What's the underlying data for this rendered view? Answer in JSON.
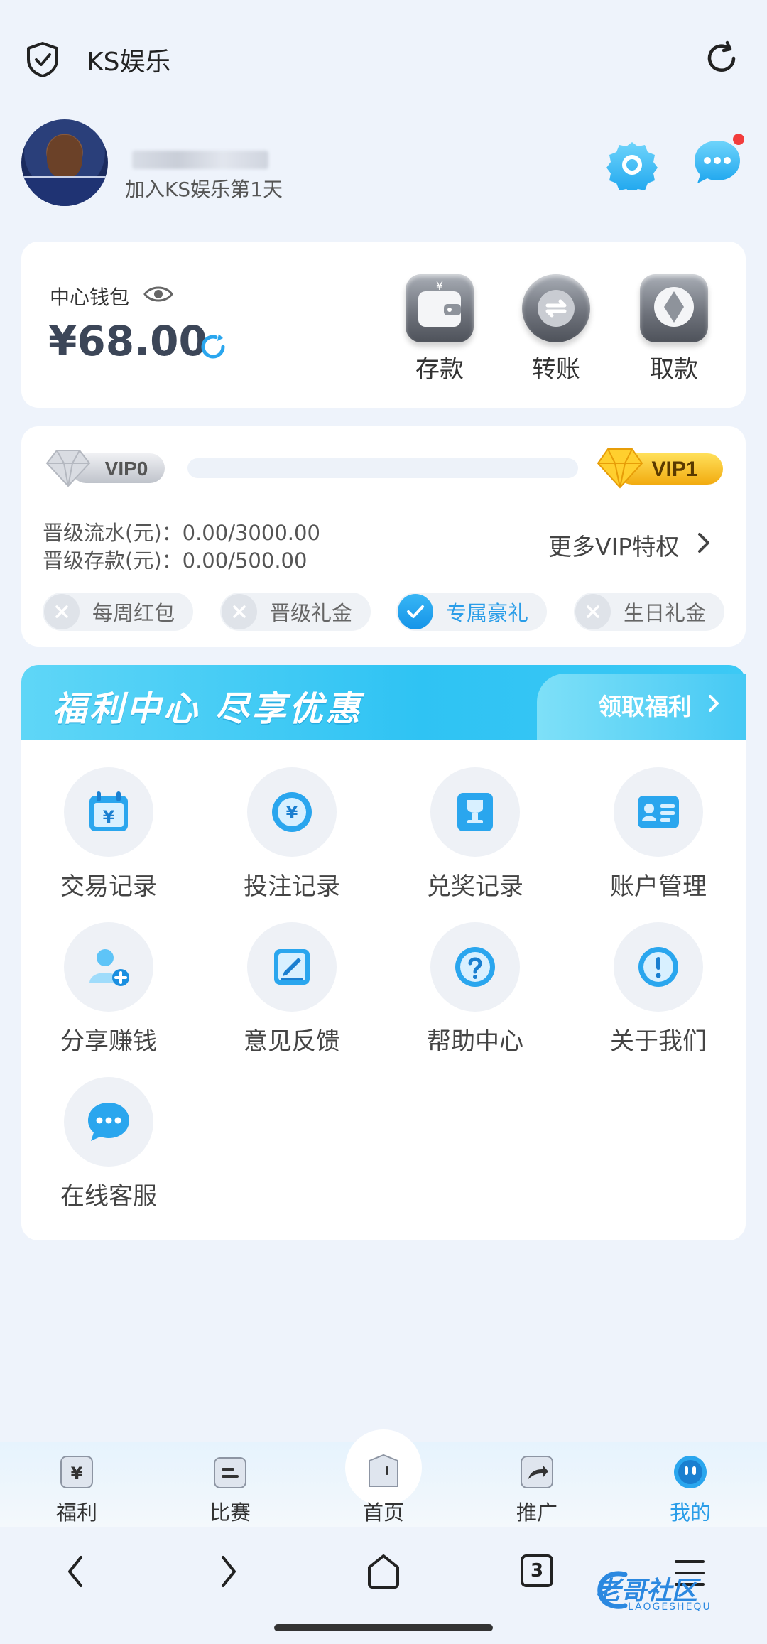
{
  "header": {
    "title": "KS娱乐"
  },
  "profile": {
    "join_text": "加入KS娱乐第1天"
  },
  "wallet": {
    "label": "中心钱包",
    "amount": "¥68.00",
    "actions": [
      {
        "label": "存款",
        "icon": "wallet-icon"
      },
      {
        "label": "转账",
        "icon": "transfer-icon"
      },
      {
        "label": "取款",
        "icon": "diamond-icon"
      }
    ]
  },
  "vip": {
    "current": "VIP0",
    "next": "VIP1",
    "progress": 0.0,
    "turnover_line": "晋级流水(元)：0.00/3000.00",
    "deposit_line": "晋级存款(元)：0.00/500.00",
    "more_label": "更多VIP特权",
    "perks": [
      {
        "label": "每周红包",
        "active": false
      },
      {
        "label": "晋级礼金",
        "active": false
      },
      {
        "label": "专属豪礼",
        "active": true
      },
      {
        "label": "生日礼金",
        "active": false
      }
    ]
  },
  "welfare": {
    "title": "福利中心 尽享优惠",
    "link": "领取福利",
    "items": [
      {
        "label": "交易记录",
        "icon": "calendar-yen-icon"
      },
      {
        "label": "投注记录",
        "icon": "coin-yen-icon"
      },
      {
        "label": "兑奖记录",
        "icon": "trophy-icon"
      },
      {
        "label": "账户管理",
        "icon": "id-card-icon"
      },
      {
        "label": "分享赚钱",
        "icon": "user-add-icon"
      },
      {
        "label": "意见反馈",
        "icon": "feedback-icon"
      },
      {
        "label": "帮助中心",
        "icon": "question-icon"
      },
      {
        "label": "关于我们",
        "icon": "info-icon"
      },
      {
        "label": "在线客服",
        "icon": "chat-icon"
      }
    ]
  },
  "tabs": [
    {
      "label": "福利",
      "active": false
    },
    {
      "label": "比赛",
      "active": false
    },
    {
      "label": "首页",
      "active": false
    },
    {
      "label": "推广",
      "active": false
    },
    {
      "label": "我的",
      "active": true
    }
  ],
  "browser": {
    "tab_count": "3"
  },
  "watermark": {
    "text": "老哥社区",
    "sub": "LAOGESHEQU"
  },
  "colors": {
    "accent": "#2a9de8",
    "banner": "#2fc3f3",
    "vip_gold": "#f7c21b",
    "notify": "#f23c3c"
  }
}
